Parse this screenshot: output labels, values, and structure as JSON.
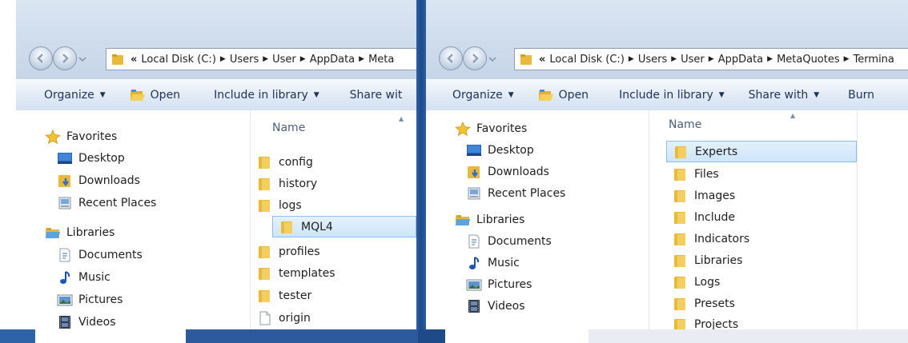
{
  "left_window": {
    "address": {
      "overflow_marker": "«",
      "crumbs": [
        "Local Disk (C:)",
        "Users",
        "User",
        "AppData",
        "Meta"
      ]
    },
    "toolbar": {
      "organize": "Organize",
      "open": "Open",
      "include_in_library": "Include in library",
      "share_with": "Share wit"
    },
    "nav": {
      "favorites": "Favorites",
      "desktop": "Desktop",
      "downloads": "Downloads",
      "recent_places": "Recent Places",
      "libraries": "Libraries",
      "documents": "Documents",
      "music": "Music",
      "pictures": "Pictures",
      "videos": "Videos"
    },
    "column_header": "Name",
    "files": [
      "config",
      "history",
      "logs",
      "MQL4",
      "profiles",
      "templates",
      "tester",
      "origin"
    ],
    "selected": "MQL4"
  },
  "right_window": {
    "address": {
      "overflow_marker": "«",
      "crumbs": [
        "Local Disk (C:)",
        "Users",
        "User",
        "AppData",
        "MetaQuotes",
        "Termina"
      ]
    },
    "toolbar": {
      "organize": "Organize",
      "open": "Open",
      "include_in_library": "Include in library",
      "share_with": "Share with",
      "burn": "Burn"
    },
    "nav": {
      "favorites": "Favorites",
      "desktop": "Desktop",
      "downloads": "Downloads",
      "recent_places": "Recent Places",
      "libraries": "Libraries",
      "documents": "Documents",
      "music": "Music",
      "pictures": "Pictures",
      "videos": "Videos"
    },
    "column_header": "Name",
    "files": [
      "Experts",
      "Files",
      "Images",
      "Include",
      "Indicators",
      "Libraries",
      "Logs",
      "Presets",
      "Projects"
    ],
    "selected": "Experts"
  },
  "icons": {
    "back": "back-arrow-icon",
    "forward": "forward-arrow-icon",
    "folder": "folder-icon",
    "star": "star-icon",
    "desktop": "desktop-icon",
    "downloads": "downloads-folder-icon",
    "recent": "recent-places-icon",
    "libraries": "libraries-icon",
    "document": "document-icon",
    "music": "music-note-icon",
    "pictures": "pictures-icon",
    "videos": "film-icon",
    "file": "text-file-icon"
  },
  "colors": {
    "titlebar": "#cfdcec",
    "toolbar": "#dfe9f5",
    "selection": "#cde5fb",
    "selection_border": "#8fbce9",
    "folder": "#e8b93a",
    "frame_blue": "#2d5fa3"
  }
}
